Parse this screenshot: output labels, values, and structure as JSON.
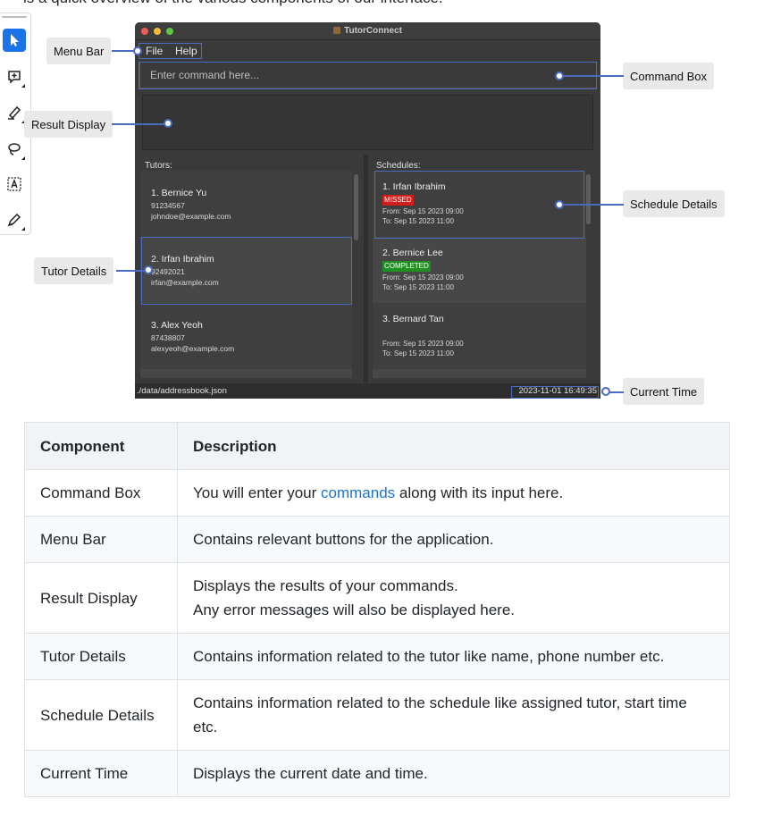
{
  "intro_text": "is a quick overview of the various components of our interface.",
  "toolbar": {
    "tools": [
      {
        "icon": "pointer-icon",
        "active": true
      },
      {
        "icon": "comment-icon"
      },
      {
        "icon": "highlighter-icon"
      },
      {
        "icon": "lasso-icon"
      },
      {
        "icon": "text-select-icon"
      },
      {
        "icon": "pen-icon"
      }
    ]
  },
  "window": {
    "title": "TutorConnect",
    "menu": {
      "file": "File",
      "help": "Help"
    },
    "command_placeholder": "Enter command here...",
    "tutors_label": "Tutors:",
    "schedules_label": "Schedules:",
    "tutors": [
      {
        "name": "1.  Bernice Yu",
        "phone": "91234567",
        "email": "johndoe@example.com"
      },
      {
        "name": "2.  Irfan Ibrahim",
        "phone": "92492021",
        "email": "irfan@example.com"
      },
      {
        "name": "3.  Alex Yeoh",
        "phone": "87438807",
        "email": "alexyeoh@example.com"
      }
    ],
    "schedules": [
      {
        "name": "1.  Irfan Ibrahim",
        "status": "MISSED",
        "from": "From: Sep 15 2023 09:00",
        "to": "To:     Sep 15 2023 11:00"
      },
      {
        "name": "2.  Bernice Lee",
        "status": "COMPLETED",
        "from": "From: Sep 15 2023 09:00",
        "to": "To:     Sep 15 2023 11:00"
      },
      {
        "name": "3.  Bernard Tan",
        "status": "",
        "from": "From: Sep 15 2023 09:00",
        "to": "To:     Sep 15 2023 11:00"
      }
    ],
    "status_path": "./data/addressbook.json",
    "status_time": "2023-11-01 16:49:35"
  },
  "callouts": {
    "menu_bar": "Menu Bar",
    "command_box": "Command Box",
    "result_display": "Result Display",
    "schedule_details": "Schedule Details",
    "tutor_details": "Tutor Details",
    "current_time": "Current Time"
  },
  "table": {
    "headers": [
      "Component",
      "Description"
    ],
    "rows": [
      {
        "component": "Command Box",
        "desc_before": "You will enter your ",
        "desc_link": "commands",
        "desc_after": " along with its input here."
      },
      {
        "component": "Menu Bar",
        "desc": "Contains relevant buttons for the application."
      },
      {
        "component": "Result Display",
        "desc": "Displays the results of your commands.",
        "desc2": "Any error messages will also be displayed here."
      },
      {
        "component": "Tutor Details",
        "desc": "Contains information related to the tutor like name, phone number etc."
      },
      {
        "component": "Schedule Details",
        "desc": "Contains information related to the schedule like assigned tutor, start time etc."
      },
      {
        "component": "Current Time",
        "desc": "Displays the current date and time."
      }
    ]
  },
  "colors": {
    "highlight": "#4a6bbf",
    "link": "#1a73c8",
    "missed": "#d21d1d",
    "completed": "#1f8f1f"
  }
}
